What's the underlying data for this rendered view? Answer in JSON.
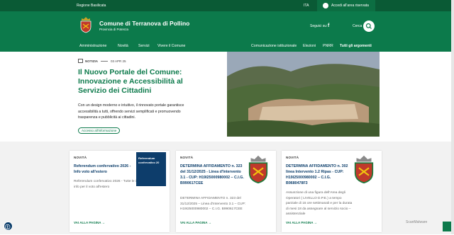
{
  "topbar": {
    "region": "Regione Basilicata",
    "lang": "ITA",
    "login": "Accedi all'area riservata"
  },
  "header": {
    "title": "Comune di Terranova di Pollino",
    "subtitle": "Provincia di Potenza",
    "follow": "Seguici su:",
    "search_label": "Cerca"
  },
  "nav": {
    "left": [
      "Amministrazione",
      "Novità",
      "Servizi",
      "Vivere il Comune"
    ],
    "right": [
      "Comunicazione istituzionale",
      "Elezioni",
      "PNRR",
      "Tutti gli argomenti"
    ]
  },
  "hero": {
    "category": "NOTIZIA",
    "date": "03 APR 25",
    "title": "Il Nuovo Portale del Comune: Innovazione e Accessibilità al Servizio dei Cittadini",
    "text": "Con un design moderno e intuitivo, il rinnovato portale garantisce accessibilità a tutti, offrendo servizi semplificati e promuovendo trasparenza e pubblicità ai cittadini.",
    "tag": "Accesso all'informazione"
  },
  "cards": [
    {
      "category": "NOVITÀ",
      "title": "Referendum confervativo 2026 - Info voto all'estero",
      "desc": "Referendum confervativo 2026 - Tutte le info info per il voto all'estero",
      "more": "VAI ALLA PAGINA",
      "thumb_text": "Referendum confervativo 20"
    },
    {
      "category": "NOVITÀ",
      "title": "DETERMINA AFFIDAMENTO n. 323 del 31/12/2025 - Linea d'Intervento 3.1 - CUP: H19I25000980002 – C.I.G. B990617CEE",
      "desc": "DETERMINA AFFIDAMENTO n. 323 del 31/12/2025 – Linea d'Intervento 3.1 – CUP: H19I25000980002 – C.I.G. B990617CEE",
      "more": "VAI ALLA PAGINA"
    },
    {
      "category": "NOVITÀ",
      "title": "DETERMINA AFFIDAMENTO n. 302 linea Intervento 1.2 Ripas - CUP: H19I25000980002 – C.I.G. B9680478F3",
      "desc": "Assunzione di una figura dell'Area degli Operatori ( LIVELLO D.P.E.) a tempo parziale di 15 ore settimanali e per la durata di mesi 18 da assegnare al servizio socio – assistenziale",
      "more": "VAI ALLA PAGINA"
    }
  ],
  "footer": {
    "watermark": "ScanMalware"
  },
  "colors": {
    "brand": "#0c7a4b",
    "topbar": "#0a5a35",
    "link": "#0c3e6b"
  }
}
